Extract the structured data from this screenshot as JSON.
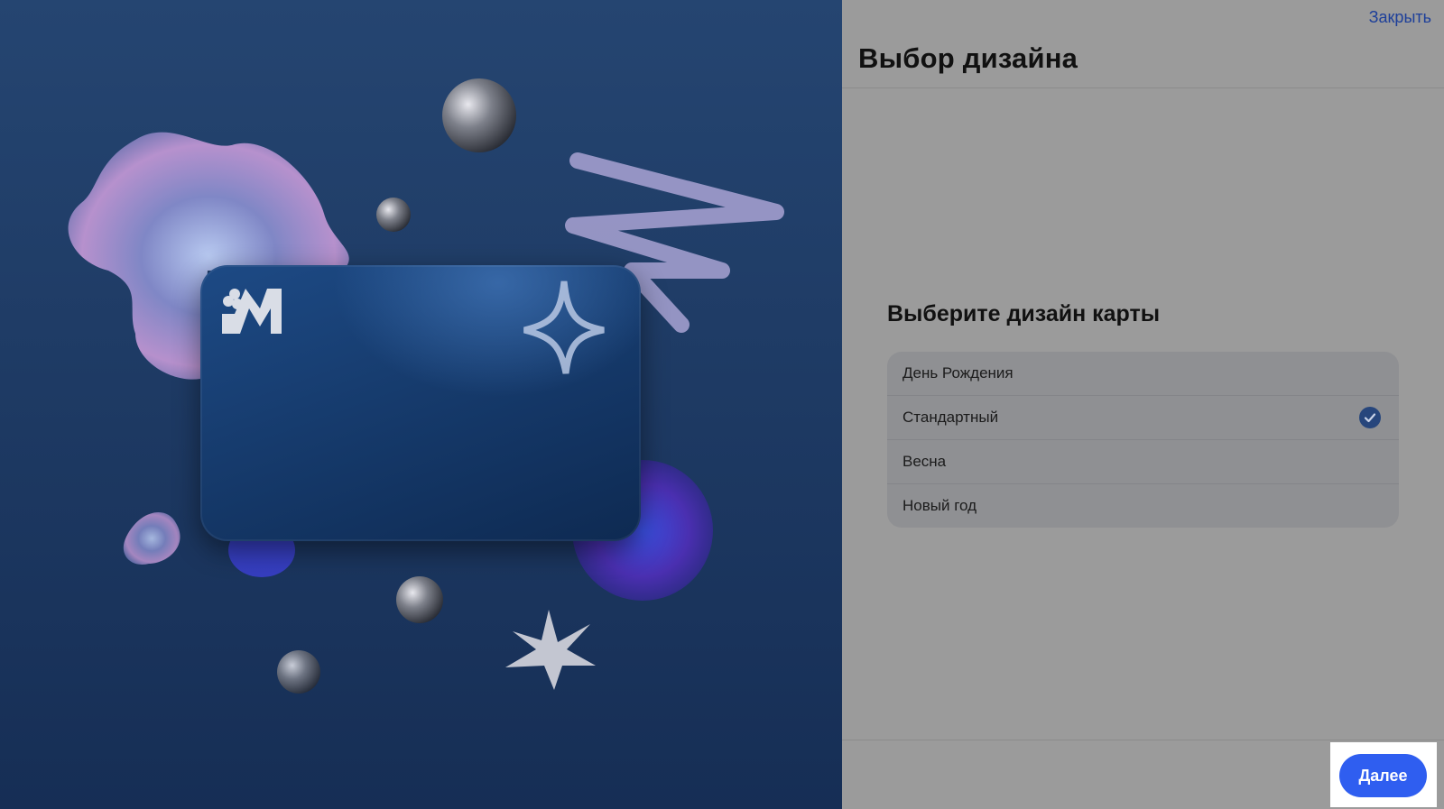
{
  "header": {
    "close_label": "Закрыть",
    "title": "Выбор дизайна"
  },
  "design_picker": {
    "heading": "Выберите дизайн карты",
    "options": [
      {
        "label": "День Рождения",
        "selected": false
      },
      {
        "label": "Стандартный",
        "selected": true
      },
      {
        "label": "Весна",
        "selected": false
      },
      {
        "label": "Новый год",
        "selected": false
      }
    ]
  },
  "footer": {
    "next_label": "Далее"
  },
  "colors": {
    "accent": "#2f5ef0",
    "link": "#1d3f9a",
    "check": "#27467c",
    "preview_bg": "#1f3c66"
  },
  "icons": {
    "card_logo": "bank-logo-icon",
    "selected_mark": "checkmark-icon"
  }
}
